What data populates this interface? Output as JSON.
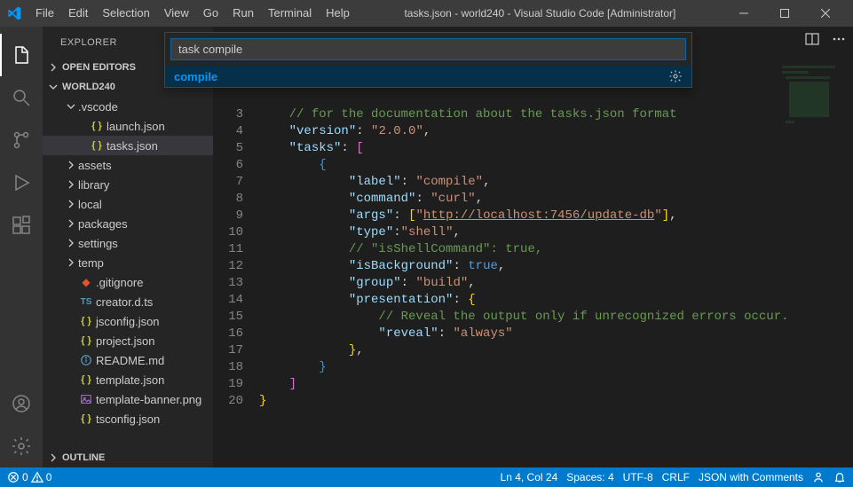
{
  "window": {
    "title": "tasks.json - world240 - Visual Studio Code [Administrator]"
  },
  "menu": [
    "File",
    "Edit",
    "Selection",
    "View",
    "Go",
    "Run",
    "Terminal",
    "Help"
  ],
  "palette": {
    "input": "task compile",
    "suggestion": "compile"
  },
  "sidebar": {
    "title": "EXPLORER",
    "sections": {
      "openEditors": "OPEN EDITORS",
      "workspace": "WORLD240",
      "outline": "OUTLINE"
    },
    "tree": [
      {
        "type": "folder",
        "label": ".vscode",
        "expanded": true,
        "indent": 1
      },
      {
        "type": "file",
        "label": "launch.json",
        "icon": "json",
        "indent": 2
      },
      {
        "type": "file",
        "label": "tasks.json",
        "icon": "json",
        "indent": 2,
        "selected": true
      },
      {
        "type": "folder",
        "label": "assets",
        "expanded": false,
        "indent": 1
      },
      {
        "type": "folder",
        "label": "library",
        "expanded": false,
        "indent": 1
      },
      {
        "type": "folder",
        "label": "local",
        "expanded": false,
        "indent": 1
      },
      {
        "type": "folder",
        "label": "packages",
        "expanded": false,
        "indent": 1
      },
      {
        "type": "folder",
        "label": "settings",
        "expanded": false,
        "indent": 1
      },
      {
        "type": "folder",
        "label": "temp",
        "expanded": false,
        "indent": 1
      },
      {
        "type": "file",
        "label": ".gitignore",
        "icon": "git",
        "indent": 1
      },
      {
        "type": "file",
        "label": "creator.d.ts",
        "icon": "ts",
        "indent": 1
      },
      {
        "type": "file",
        "label": "jsconfig.json",
        "icon": "json",
        "indent": 1
      },
      {
        "type": "file",
        "label": "project.json",
        "icon": "json",
        "indent": 1
      },
      {
        "type": "file",
        "label": "README.md",
        "icon": "md",
        "indent": 1
      },
      {
        "type": "file",
        "label": "template.json",
        "icon": "json",
        "indent": 1
      },
      {
        "type": "file",
        "label": "template-banner.png",
        "icon": "img",
        "indent": 1
      },
      {
        "type": "file",
        "label": "tsconfig.json",
        "icon": "json",
        "indent": 1
      }
    ]
  },
  "editor": {
    "lineStart": 3,
    "lines": [
      {
        "n": 3,
        "html": "    <span class='s-com'>// for the documentation about the tasks.json format</span>"
      },
      {
        "n": 4,
        "html": "    <span class='s-key'>\"version\"</span><span class='s-punc'>:</span> <span class='s-str'>\"2.0.0\"</span><span class='s-punc'>,</span>"
      },
      {
        "n": 5,
        "html": "    <span class='s-key'>\"tasks\"</span><span class='s-punc'>:</span> <span class='s-brk2'>[</span>"
      },
      {
        "n": 6,
        "html": "        <span class='s-brk3'>{</span>"
      },
      {
        "n": 7,
        "html": "            <span class='s-key'>\"label\"</span><span class='s-punc'>:</span> <span class='s-str'>\"compile\"</span><span class='s-punc'>,</span>"
      },
      {
        "n": 8,
        "html": "            <span class='s-key'>\"command\"</span><span class='s-punc'>:</span> <span class='s-str'>\"curl\"</span><span class='s-punc'>,</span>"
      },
      {
        "n": 9,
        "html": "            <span class='s-key'>\"args\"</span><span class='s-punc'>:</span> <span class='s-brk1'>[</span><span class='s-str'>\"</span><span class='s-str-u'>http://localhost:7456/update-db</span><span class='s-str'>\"</span><span class='s-brk1'>]</span><span class='s-punc'>,</span>"
      },
      {
        "n": 10,
        "html": "            <span class='s-key'>\"type\"</span><span class='s-punc'>:</span><span class='s-str'>\"shell\"</span><span class='s-punc'>,</span>"
      },
      {
        "n": 11,
        "html": "            <span class='s-com'>// \"isShellCommand\": true,</span>"
      },
      {
        "n": 12,
        "html": "            <span class='s-key'>\"isBackground\"</span><span class='s-punc'>:</span> <span class='s-bool'>true</span><span class='s-punc'>,</span>"
      },
      {
        "n": 13,
        "html": "            <span class='s-key'>\"group\"</span><span class='s-punc'>:</span> <span class='s-str'>\"build\"</span><span class='s-punc'>,</span>"
      },
      {
        "n": 14,
        "html": "            <span class='s-key'>\"presentation\"</span><span class='s-punc'>:</span> <span class='s-brk1'>{</span>"
      },
      {
        "n": 15,
        "html": "                <span class='s-com'>// Reveal the output only if unrecognized errors occur.</span>"
      },
      {
        "n": 16,
        "html": "                <span class='s-key'>\"reveal\"</span><span class='s-punc'>:</span> <span class='s-str'>\"always\"</span>"
      },
      {
        "n": 17,
        "html": "            <span class='s-brk1'>}</span><span class='s-punc'>,</span>"
      },
      {
        "n": 18,
        "html": "        <span class='s-brk3'>}</span>"
      },
      {
        "n": 19,
        "html": "    <span class='s-brk2'>]</span>"
      },
      {
        "n": 20,
        "html": "<span class='s-brk1'>}</span>"
      }
    ]
  },
  "status": {
    "errors": "0",
    "warnings": "0",
    "line_col": "Ln 4, Col 24",
    "spaces": "Spaces: 4",
    "encoding": "UTF-8",
    "eol": "CRLF",
    "lang": "JSON with Comments"
  }
}
